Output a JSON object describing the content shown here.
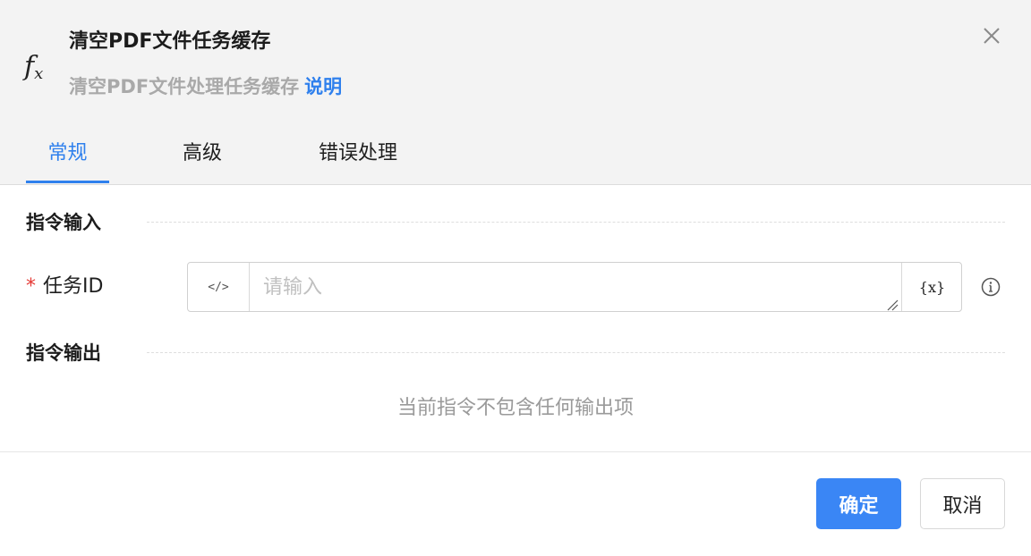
{
  "header": {
    "icon": "fx-icon",
    "title": "清空PDF文件任务缓存",
    "subtitle": "清空PDF文件处理任务缓存",
    "help_link": "说明",
    "close_icon": "close-icon"
  },
  "tabs": [
    {
      "label": "常规",
      "active": true
    },
    {
      "label": "高级",
      "active": false
    },
    {
      "label": "错误处理",
      "active": false
    }
  ],
  "input_section": {
    "title": "指令输入",
    "fields": [
      {
        "required_mark": "*",
        "label": "任务ID",
        "value": "",
        "placeholder": "请输入",
        "code_toggle_label": "</>",
        "variable_button_label": "{x}",
        "info_icon": "info-icon"
      }
    ]
  },
  "output_section": {
    "title": "指令输出",
    "empty_text": "当前指令不包含任何输出项"
  },
  "footer": {
    "ok_label": "确定",
    "cancel_label": "取消"
  },
  "colors": {
    "accent": "#2f80ed",
    "primary_button": "#3a86f5",
    "required": "#e53935",
    "header_bg": "#f3f3f3"
  }
}
